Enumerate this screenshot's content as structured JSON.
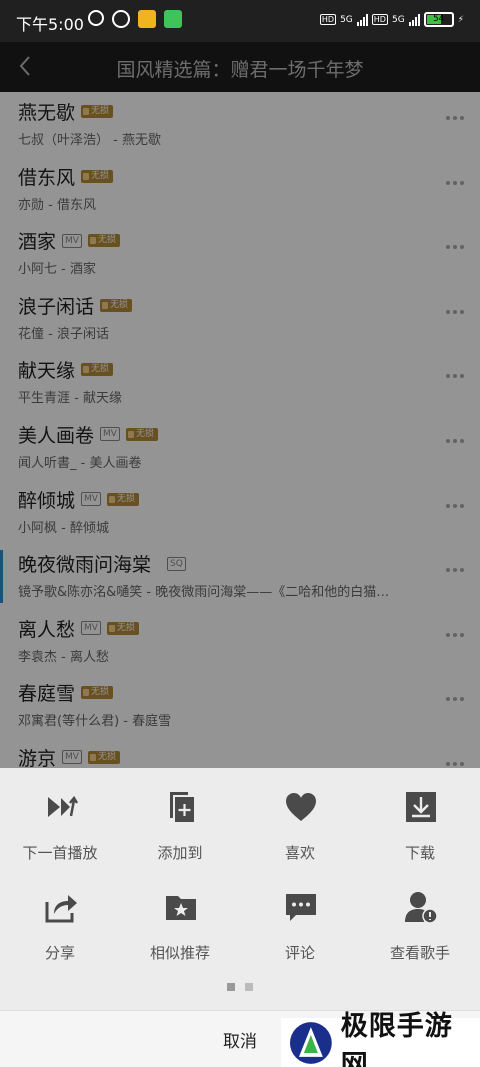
{
  "status": {
    "time": "下午5:00",
    "hd1": "HD",
    "net1": "5G",
    "hd2": "HD",
    "net2": "5G",
    "battery": "54"
  },
  "header": {
    "title": "国风精选篇：赠君一场千年梦"
  },
  "songs": [
    {
      "name": "燕无歇",
      "mv": false,
      "sq": false,
      "wuxian": true,
      "sub": "七叔（叶泽浩） - 燕无歇"
    },
    {
      "name": "借东风",
      "mv": false,
      "sq": false,
      "wuxian": true,
      "sub": "亦勋 - 借东风"
    },
    {
      "name": "酒家",
      "mv": true,
      "sq": false,
      "wuxian": true,
      "sub": "小阿七 - 酒家"
    },
    {
      "name": "浪子闲话",
      "mv": false,
      "sq": false,
      "wuxian": true,
      "sub": "花僮 - 浪子闲话"
    },
    {
      "name": "献天缘",
      "mv": false,
      "sq": false,
      "wuxian": true,
      "sub": "平生青涯 - 献天缘"
    },
    {
      "name": "美人画卷",
      "mv": true,
      "sq": false,
      "wuxian": true,
      "sub": "闻人听書_ - 美人画卷"
    },
    {
      "name": "醉倾城",
      "mv": true,
      "sq": false,
      "wuxian": true,
      "sub": "小阿枫 - 醉倾城"
    },
    {
      "name": "晚夜微雨问海棠",
      "mv": false,
      "sq": true,
      "wuxian": false,
      "sub": "镜予歌&陈亦洺&嗵笑 - 晚夜微雨问海棠——《二哈和他的白猫…"
    },
    {
      "name": "离人愁",
      "mv": true,
      "sq": false,
      "wuxian": true,
      "sub": "李袁杰 - 离人愁"
    },
    {
      "name": "春庭雪",
      "mv": false,
      "sq": false,
      "wuxian": true,
      "sub": "邓寓君(等什么君) - 春庭雪"
    },
    {
      "name": "游京",
      "mv": true,
      "sq": false,
      "wuxian": true,
      "sub": ""
    }
  ],
  "tags": {
    "mv": "MV",
    "sq": "SQ",
    "wuxian": "无损"
  },
  "sheet": {
    "actions": [
      {
        "label": "下一首播放",
        "icon": "play-next-icon"
      },
      {
        "label": "添加到",
        "icon": "add-to-icon"
      },
      {
        "label": "喜欢",
        "icon": "heart-icon"
      },
      {
        "label": "下载",
        "icon": "download-icon"
      },
      {
        "label": "分享",
        "icon": "share-icon"
      },
      {
        "label": "相似推荐",
        "icon": "similar-folder-icon"
      },
      {
        "label": "评论",
        "icon": "comment-icon"
      },
      {
        "label": "查看歌手",
        "icon": "artist-icon"
      }
    ],
    "cancel": "取消"
  },
  "watermark": {
    "text": "极限手游网"
  },
  "colors": {
    "accent": "#2a8fd8",
    "sheet_bg": "#ececec",
    "icon": "#4a4a4a"
  }
}
